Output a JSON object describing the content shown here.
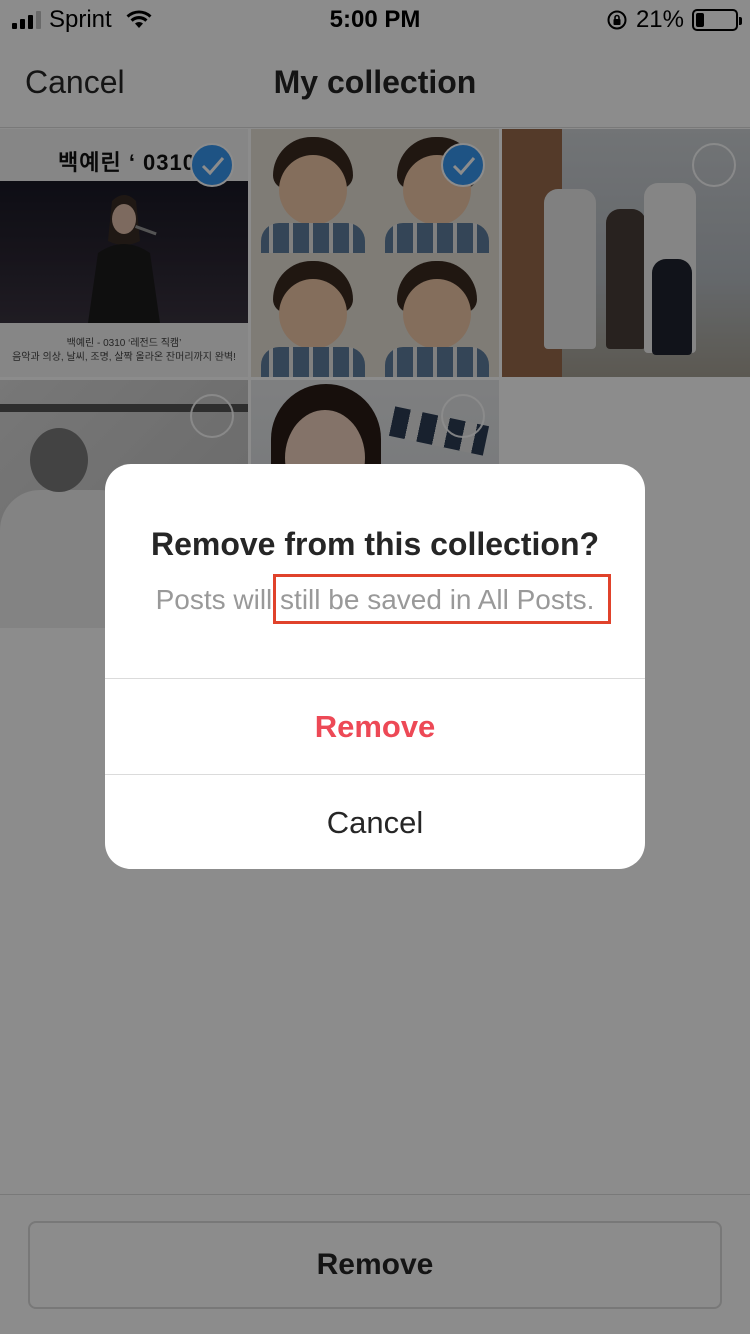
{
  "status_bar": {
    "carrier": "Sprint",
    "time": "5:00 PM",
    "battery_percent": "21%",
    "battery_level": 0.21,
    "icons": [
      "signal-icon",
      "wifi-icon",
      "rotation-lock-icon",
      "battery-icon"
    ]
  },
  "nav": {
    "cancel_label": "Cancel",
    "title": "My collection"
  },
  "grid": {
    "tiles": [
      {
        "title_text": "백예린 ‘ 0310 ’",
        "caption_line1": "백예린 - 0310 ‘레전드 직캠’",
        "caption_line2": "음악과 의상, 날씨, 조명, 살짝 올라온 잔머리까지 완벽!",
        "selected": true
      },
      {
        "selected": true
      },
      {
        "selected": false
      },
      {
        "selected": false
      },
      {
        "selected": false
      }
    ],
    "accent_color": "#3897f0"
  },
  "dialog": {
    "title": "Remove from this collection?",
    "message": "Posts will still be saved in All Posts.",
    "remove_label": "Remove",
    "cancel_label": "Cancel",
    "remove_color": "#ed4956",
    "highlight_color": "#e0422b"
  },
  "bottom_bar": {
    "remove_label": "Remove"
  }
}
